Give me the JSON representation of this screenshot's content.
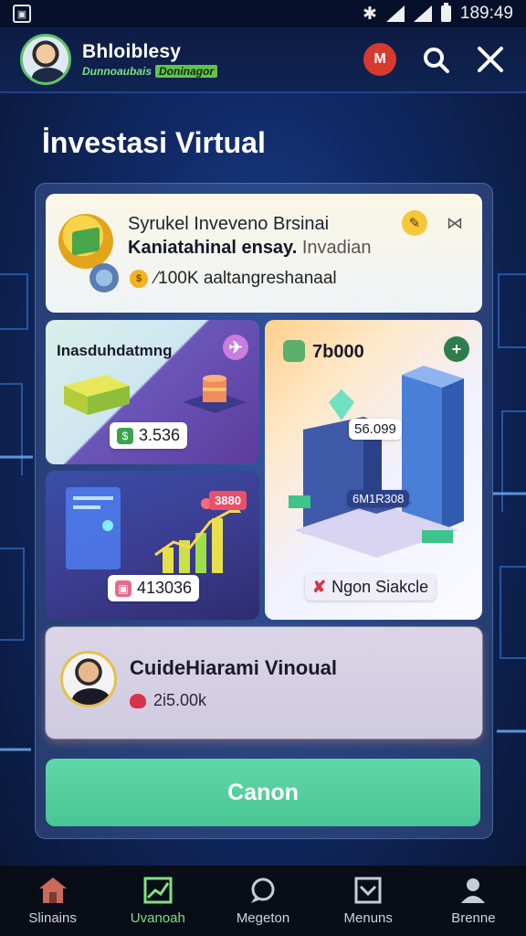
{
  "status_bar": {
    "time": "189:49"
  },
  "header": {
    "brand_name": "Bhloiblesy",
    "brand_sub_a": "Dunnoaubais",
    "brand_sub_b": "Doninagor",
    "notif_label": "M"
  },
  "page": {
    "title": "İnvestasi Virtual"
  },
  "summary": {
    "title": "Syrukel Inveveno Brsinai",
    "subtitle_bold": "Kaniatahinal ensay.",
    "subtitle_muted": "Invadian",
    "amount": "⁄100K aaltangreshanaal",
    "coin_glyph": "$"
  },
  "tiles": {
    "a": {
      "title": "Inasduhdatmng",
      "value": "3.536",
      "chip_icon": "$"
    },
    "b": {
      "title": "7b000",
      "screen_value": "56.099",
      "badge": "6M1R308",
      "footer": "Ngon Siakcle"
    },
    "c": {
      "tag": "3880",
      "value": "413036"
    }
  },
  "profile": {
    "name": "CuideHiarami Vinoual",
    "amount": "2i5.00k"
  },
  "cta": {
    "label": "Canon"
  },
  "nav": [
    {
      "label": "Slinains",
      "icon": "home-icon"
    },
    {
      "label": "Uvanoah",
      "icon": "chart-icon"
    },
    {
      "label": "Megeton",
      "icon": "chat-icon"
    },
    {
      "label": "Menuns",
      "icon": "box-icon"
    },
    {
      "label": "Brenne",
      "icon": "profile-icon"
    }
  ],
  "colors": {
    "accent": "#49c596",
    "nav_active": "#7fe07f",
    "background": "#112a66"
  }
}
